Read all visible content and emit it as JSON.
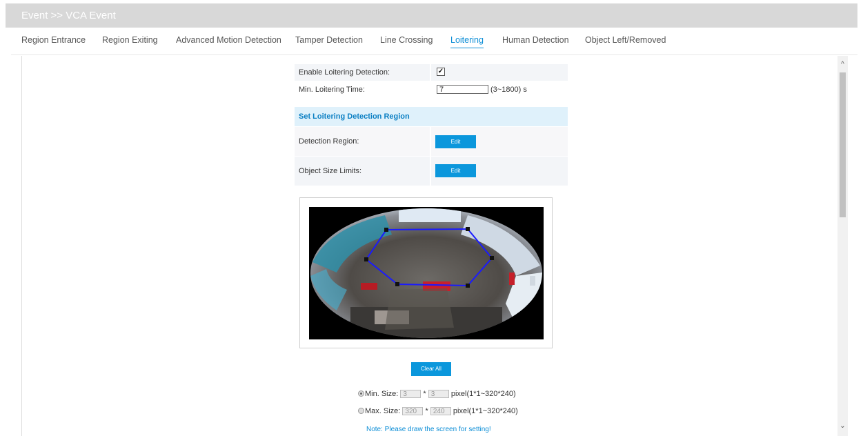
{
  "header": {
    "breadcrumb": "Event >> VCA Event"
  },
  "tabs": [
    {
      "label": "Region Entrance",
      "active": false
    },
    {
      "label": "Region Exiting",
      "active": false
    },
    {
      "label": "Advanced Motion Detection",
      "active": false
    },
    {
      "label": "Tamper Detection",
      "active": false
    },
    {
      "label": "Line Crossing",
      "active": false
    },
    {
      "label": "Loitering",
      "active": true
    },
    {
      "label": "Human Detection",
      "active": false
    },
    {
      "label": "Object Left/Removed",
      "active": false
    }
  ],
  "form": {
    "enable_label": "Enable Loitering Detection:",
    "enable_checked": true,
    "min_time_label": "Min. Loitering Time:",
    "min_time_value": "7",
    "min_time_range": "(3~1800) s",
    "section_title": "Set Loitering Detection Region",
    "detection_region_label": "Detection Region:",
    "object_size_label": "Object Size Limits:",
    "edit_label": "Edit"
  },
  "clear_all_label": "Clear All",
  "min_size": {
    "label": "Min. Size:",
    "w": "3",
    "h": "3",
    "range": "pixel(1*1~320*240)",
    "selected": true
  },
  "max_size": {
    "label": "Max. Size:",
    "w": "320",
    "h": "240",
    "range": "pixel(1*1~320*240)",
    "selected": false
  },
  "size_separator": "*",
  "note": "Note: Please draw the screen for setting!",
  "colors": {
    "accent": "#0b97dc",
    "header_bg": "#d8d8d8",
    "section_bg": "#dff1fb",
    "region_line": "#1a1aff"
  },
  "icons": {
    "scroll_up": "chevron-up-icon",
    "scroll_down": "chevron-down-icon"
  }
}
